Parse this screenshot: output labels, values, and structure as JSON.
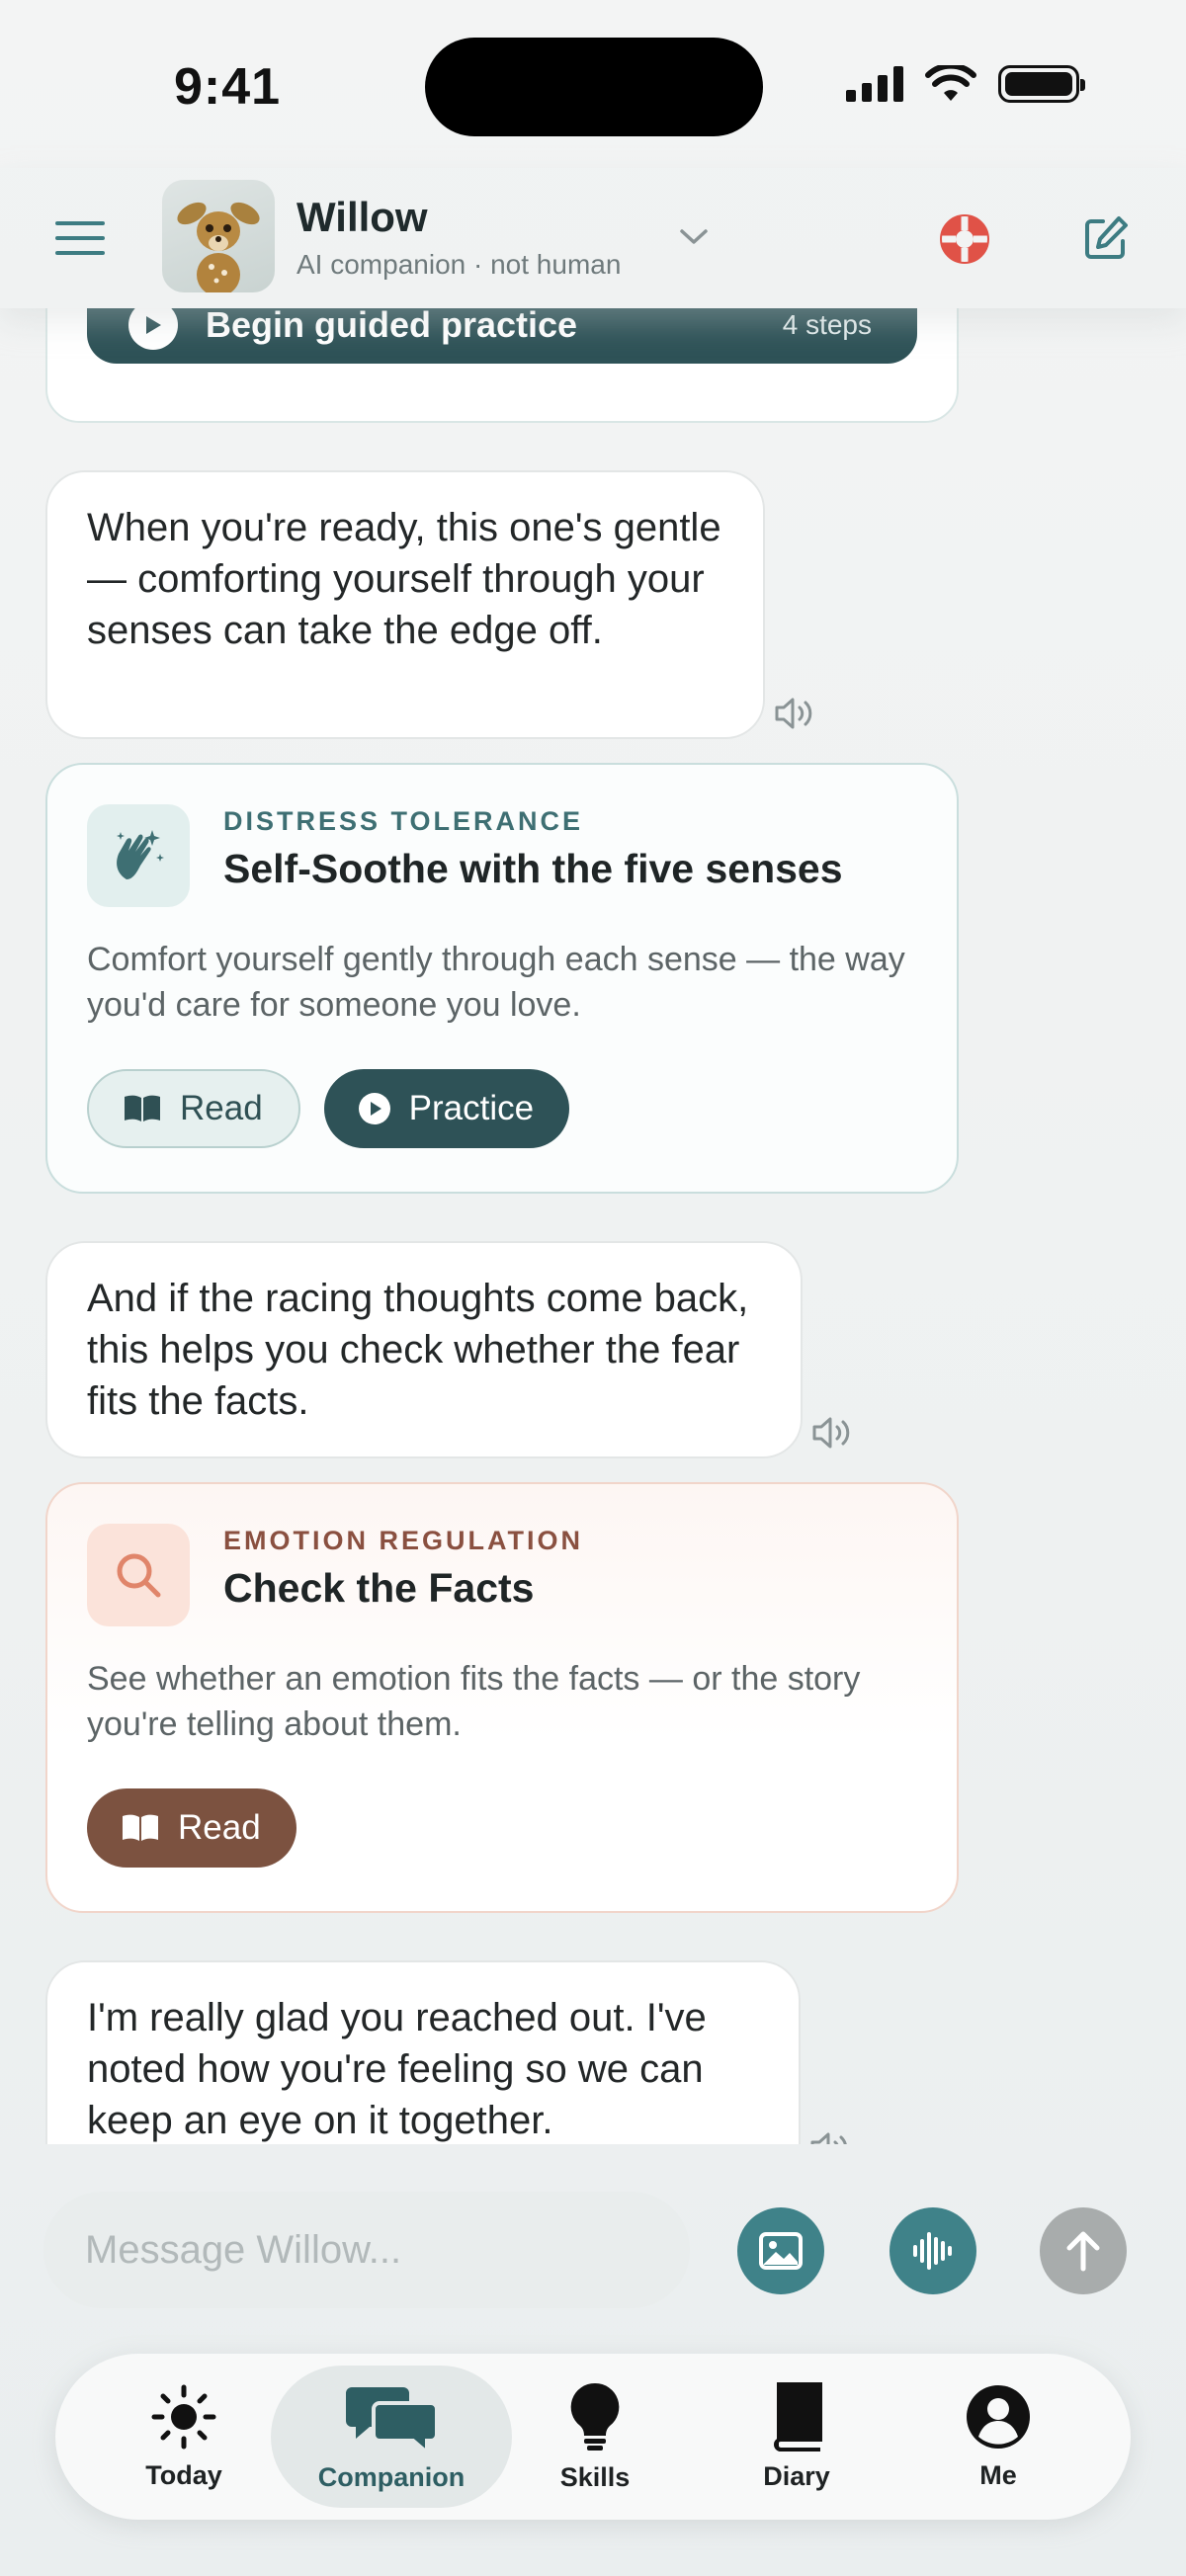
{
  "status_bar": {
    "time": "9:41"
  },
  "header": {
    "name": "Willow",
    "subtitle": "AI companion · not human"
  },
  "prev_card": {
    "button_label": "Begin guided practice",
    "steps": "4 steps"
  },
  "messages": [
    {
      "text": "When you're ready, this one's gentle — comforting yourself through your senses can take the edge off."
    },
    {
      "text": "And if the racing thoughts come back, this helps you check whether the fear fits the facts."
    },
    {
      "text": "I'm really glad you reached out. I've noted how you're feeling so we can keep an eye on it together."
    }
  ],
  "skills": [
    {
      "category": "DISTRESS TOLERANCE",
      "title": "Self-Soothe with the five senses",
      "description": "Comfort yourself gently through each sense — the way you'd care for someone you love.",
      "read_label": "Read",
      "practice_label": "Practice",
      "icon": "hands-sparkle-icon",
      "accent": "#2e5257"
    },
    {
      "category": "EMOTION REGULATION",
      "title": "Check the Facts",
      "description": "See whether an emotion fits the facts — or the story you're telling about them.",
      "read_label": "Read",
      "icon": "search-icon",
      "accent": "#7c5240"
    }
  ],
  "composer": {
    "placeholder": "Message Willow..."
  },
  "tabs": [
    {
      "label": "Today",
      "icon": "sun-icon"
    },
    {
      "label": "Companion",
      "icon": "chat-bubbles-icon",
      "active": true
    },
    {
      "label": "Skills",
      "icon": "lightbulb-icon"
    },
    {
      "label": "Diary",
      "icon": "book-icon"
    },
    {
      "label": "Me",
      "icon": "person-icon"
    }
  ],
  "colors": {
    "primary": "#2e5257",
    "teal_accent": "#3f8289",
    "brown_accent": "#7c5240",
    "sos_red": "#e05247"
  }
}
